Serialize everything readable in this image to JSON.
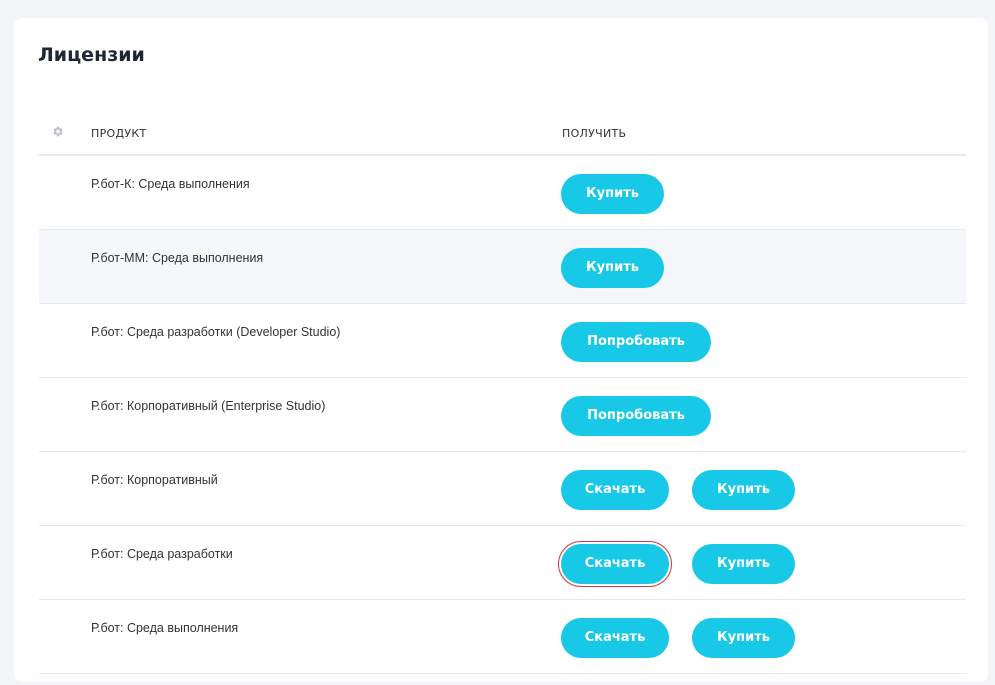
{
  "page": {
    "title": "Лицензии"
  },
  "table": {
    "headers": {
      "product": "ПРОДУКТ",
      "get": "ПОЛУЧИТЬ"
    },
    "rows": [
      {
        "product": "Р.бот-К: Среда выполнения",
        "buttons": {
          "buy": "Купить"
        }
      },
      {
        "product": "Р.бот-ММ: Среда выполнения",
        "buttons": {
          "buy": "Купить"
        }
      },
      {
        "product": "Р.бот: Среда разработки (Developer Studio)",
        "buttons": {
          "try": "Попробовать"
        }
      },
      {
        "product": "Р.бот: Корпоративный (Enterprise Studio)",
        "buttons": {
          "try": "Попробовать"
        }
      },
      {
        "product": "Р.бот: Корпоративный",
        "buttons": {
          "download": "Скачать",
          "buy": "Купить"
        }
      },
      {
        "product": "Р.бот: Среда разработки",
        "buttons": {
          "download": "Скачать",
          "buy": "Купить"
        }
      },
      {
        "product": "Р.бот: Среда выполнения",
        "buttons": {
          "download": "Скачать",
          "buy": "Купить"
        }
      }
    ]
  },
  "icons": {
    "settings": "gear-icon"
  },
  "colors": {
    "accent": "#17c9e6",
    "row_alt": "#f5f7fa",
    "highlight": "#d23c3c"
  }
}
